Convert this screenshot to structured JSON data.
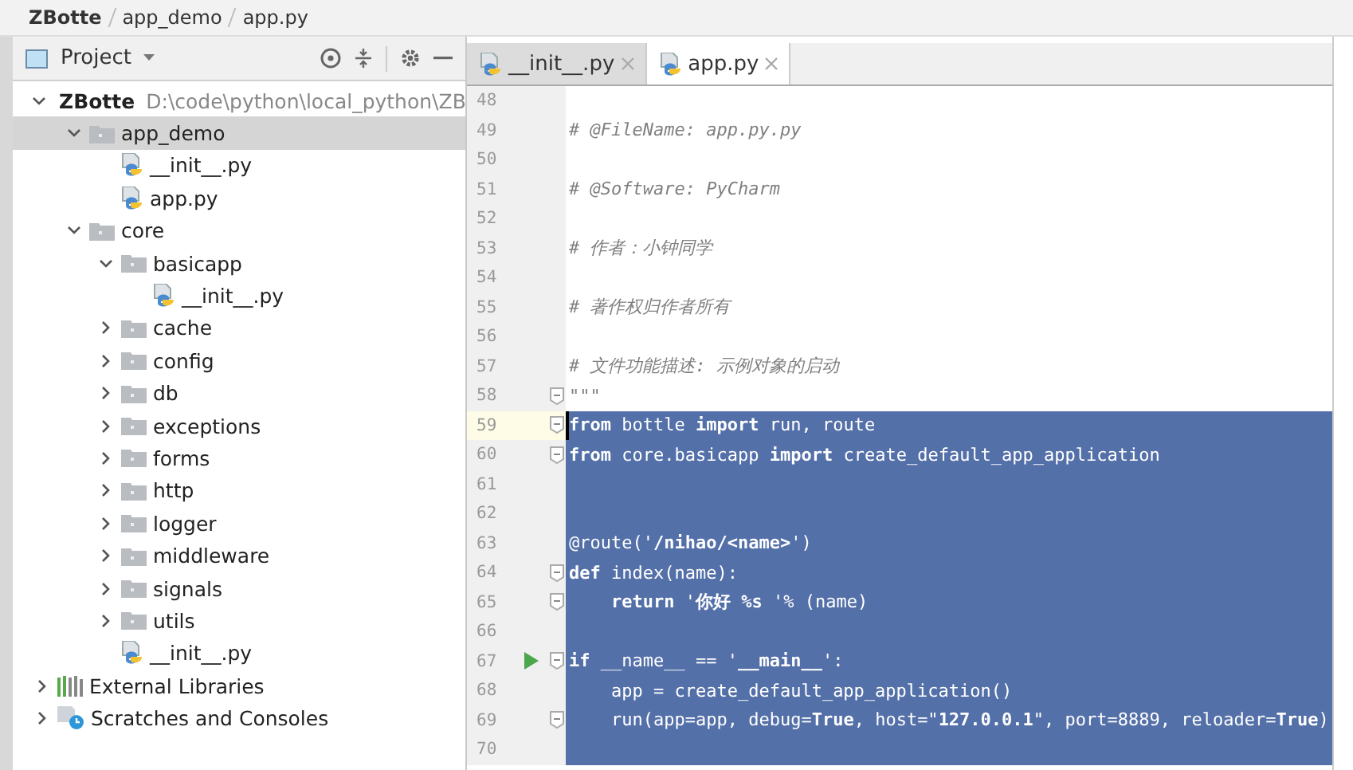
{
  "breadcrumb": [
    "ZBotte",
    "app_demo",
    "app.py"
  ],
  "project_panel": {
    "title": "Project",
    "tree": [
      {
        "kind": "folder",
        "label": "ZBotte",
        "path": "D:\\code\\python\\local_python\\ZB",
        "expanded": true,
        "selected": false,
        "children": [
          {
            "kind": "folder",
            "label": "app_demo",
            "expanded": true,
            "selected": true,
            "children": [
              {
                "kind": "file",
                "label": "__init__.py",
                "selected": false
              },
              {
                "kind": "file",
                "label": "app.py",
                "selected": false
              }
            ]
          },
          {
            "kind": "folder",
            "label": "core",
            "expanded": true,
            "selected": false,
            "children": [
              {
                "kind": "folder",
                "label": "basicapp",
                "expanded": true,
                "selected": false,
                "children": [
                  {
                    "kind": "file",
                    "label": "__init__.py",
                    "selected": false
                  }
                ]
              },
              {
                "kind": "folder",
                "label": "cache",
                "expanded": false,
                "selected": false
              },
              {
                "kind": "folder",
                "label": "config",
                "expanded": false,
                "selected": false
              },
              {
                "kind": "folder",
                "label": "db",
                "expanded": false,
                "selected": false
              },
              {
                "kind": "folder",
                "label": "exceptions",
                "expanded": false,
                "selected": false
              },
              {
                "kind": "folder",
                "label": "forms",
                "expanded": false,
                "selected": false
              },
              {
                "kind": "folder",
                "label": "http",
                "expanded": false,
                "selected": false
              },
              {
                "kind": "folder",
                "label": "logger",
                "expanded": false,
                "selected": false
              },
              {
                "kind": "folder",
                "label": "middleware",
                "expanded": false,
                "selected": false
              },
              {
                "kind": "folder",
                "label": "signals",
                "expanded": false,
                "selected": false
              },
              {
                "kind": "folder",
                "label": "utils",
                "expanded": false,
                "selected": false
              },
              {
                "kind": "file",
                "label": "__init__.py",
                "selected": false
              }
            ]
          }
        ]
      },
      {
        "kind": "library",
        "label": "External Libraries",
        "expanded": false,
        "selected": false
      },
      {
        "kind": "scratches",
        "label": "Scratches and Consoles",
        "expanded": false,
        "selected": false
      }
    ]
  },
  "tabs": [
    {
      "label": "__init__.py",
      "selected": false
    },
    {
      "label": "app.py",
      "selected": true
    }
  ],
  "code_lines": [
    {
      "number": "48",
      "selected": false,
      "current": false,
      "fold": false,
      "run": false
    },
    {
      "number": "49",
      "selected": false,
      "current": false,
      "fold": false,
      "run": false,
      "tokens": [
        {
          "kind": "comment",
          "text": "# @FileName: app.py.py"
        }
      ]
    },
    {
      "number": "50",
      "selected": false,
      "current": false,
      "fold": false,
      "run": false
    },
    {
      "number": "51",
      "selected": false,
      "current": false,
      "fold": false,
      "run": false,
      "tokens": [
        {
          "kind": "comment",
          "text": "# @Software: PyCharm"
        }
      ]
    },
    {
      "number": "52",
      "selected": false,
      "current": false,
      "fold": false,
      "run": false
    },
    {
      "number": "53",
      "selected": false,
      "current": false,
      "fold": false,
      "run": false,
      "tokens": [
        {
          "kind": "comment",
          "text": "# 作者：小钟同学"
        }
      ]
    },
    {
      "number": "54",
      "selected": false,
      "current": false,
      "fold": false,
      "run": false
    },
    {
      "number": "55",
      "selected": false,
      "current": false,
      "fold": false,
      "run": false,
      "tokens": [
        {
          "kind": "comment",
          "text": "# 著作权归作者所有"
        }
      ]
    },
    {
      "number": "56",
      "selected": false,
      "current": false,
      "fold": false,
      "run": false
    },
    {
      "number": "57",
      "selected": false,
      "current": false,
      "fold": false,
      "run": false,
      "tokens": [
        {
          "kind": "comment",
          "text": "# 文件功能描述: 示例对象的启动"
        }
      ]
    },
    {
      "number": "58",
      "selected": false,
      "current": false,
      "fold": true,
      "run": false,
      "tokens": [
        {
          "kind": "comment",
          "text": "\"\"\""
        }
      ]
    },
    {
      "number": "59",
      "selected": true,
      "current": true,
      "fold": true,
      "run": false,
      "tokens": [
        {
          "kind": "keyword",
          "text": "from"
        },
        {
          "kind": "plain",
          "text": " bottle "
        },
        {
          "kind": "keyword",
          "text": "import"
        },
        {
          "kind": "plain",
          "text": " run, route"
        }
      ]
    },
    {
      "number": "60",
      "selected": true,
      "current": false,
      "fold": true,
      "run": false,
      "tokens": [
        {
          "kind": "keyword",
          "text": "from"
        },
        {
          "kind": "plain",
          "text": " core.basicapp "
        },
        {
          "kind": "keyword",
          "text": "import"
        },
        {
          "kind": "plain",
          "text": " create_default_app_application"
        }
      ]
    },
    {
      "number": "61",
      "selected": true,
      "current": false,
      "fold": false,
      "run": false
    },
    {
      "number": "62",
      "selected": true,
      "current": false,
      "fold": false,
      "run": false
    },
    {
      "number": "63",
      "selected": true,
      "current": false,
      "fold": false,
      "run": false,
      "tokens": [
        {
          "kind": "plain",
          "text": "@route('"
        },
        {
          "kind": "string",
          "text": "/nihao/<name>"
        },
        {
          "kind": "plain",
          "text": "')"
        }
      ]
    },
    {
      "number": "64",
      "selected": true,
      "current": false,
      "fold": true,
      "run": false,
      "tokens": [
        {
          "kind": "keyword",
          "text": "def"
        },
        {
          "kind": "plain",
          "text": " index(name):"
        }
      ]
    },
    {
      "number": "65",
      "selected": true,
      "current": false,
      "fold": true,
      "run": false,
      "tokens": [
        {
          "kind": "keyword",
          "text": "    return"
        },
        {
          "kind": "plain",
          "text": " '"
        },
        {
          "kind": "string",
          "text": "你好 %s "
        },
        {
          "kind": "plain",
          "text": "'% (name)"
        }
      ]
    },
    {
      "number": "66",
      "selected": true,
      "current": false,
      "fold": false,
      "run": false
    },
    {
      "number": "67",
      "selected": true,
      "current": false,
      "fold": true,
      "run": true,
      "tokens": [
        {
          "kind": "keyword",
          "text": "if"
        },
        {
          "kind": "plain",
          "text": " __name__ == '"
        },
        {
          "kind": "string",
          "text": "__main__"
        },
        {
          "kind": "plain",
          "text": "':"
        }
      ]
    },
    {
      "number": "68",
      "selected": true,
      "current": false,
      "fold": false,
      "run": false,
      "tokens": [
        {
          "kind": "plain",
          "text": "    app = create_default_app_application()"
        }
      ]
    },
    {
      "number": "69",
      "selected": true,
      "current": false,
      "fold": true,
      "run": false,
      "tokens": [
        {
          "kind": "plain",
          "text": "    run(app=app, debug="
        },
        {
          "kind": "keyword",
          "text": "True"
        },
        {
          "kind": "plain",
          "text": ", host=\""
        },
        {
          "kind": "string",
          "text": "127.0.0.1"
        },
        {
          "kind": "plain",
          "text": "\", port=8889, reloader="
        },
        {
          "kind": "keyword",
          "text": "True"
        },
        {
          "kind": "plain",
          "text": ")"
        }
      ]
    },
    {
      "number": "70",
      "selected": true,
      "current": false,
      "fold": false,
      "run": false
    }
  ]
}
